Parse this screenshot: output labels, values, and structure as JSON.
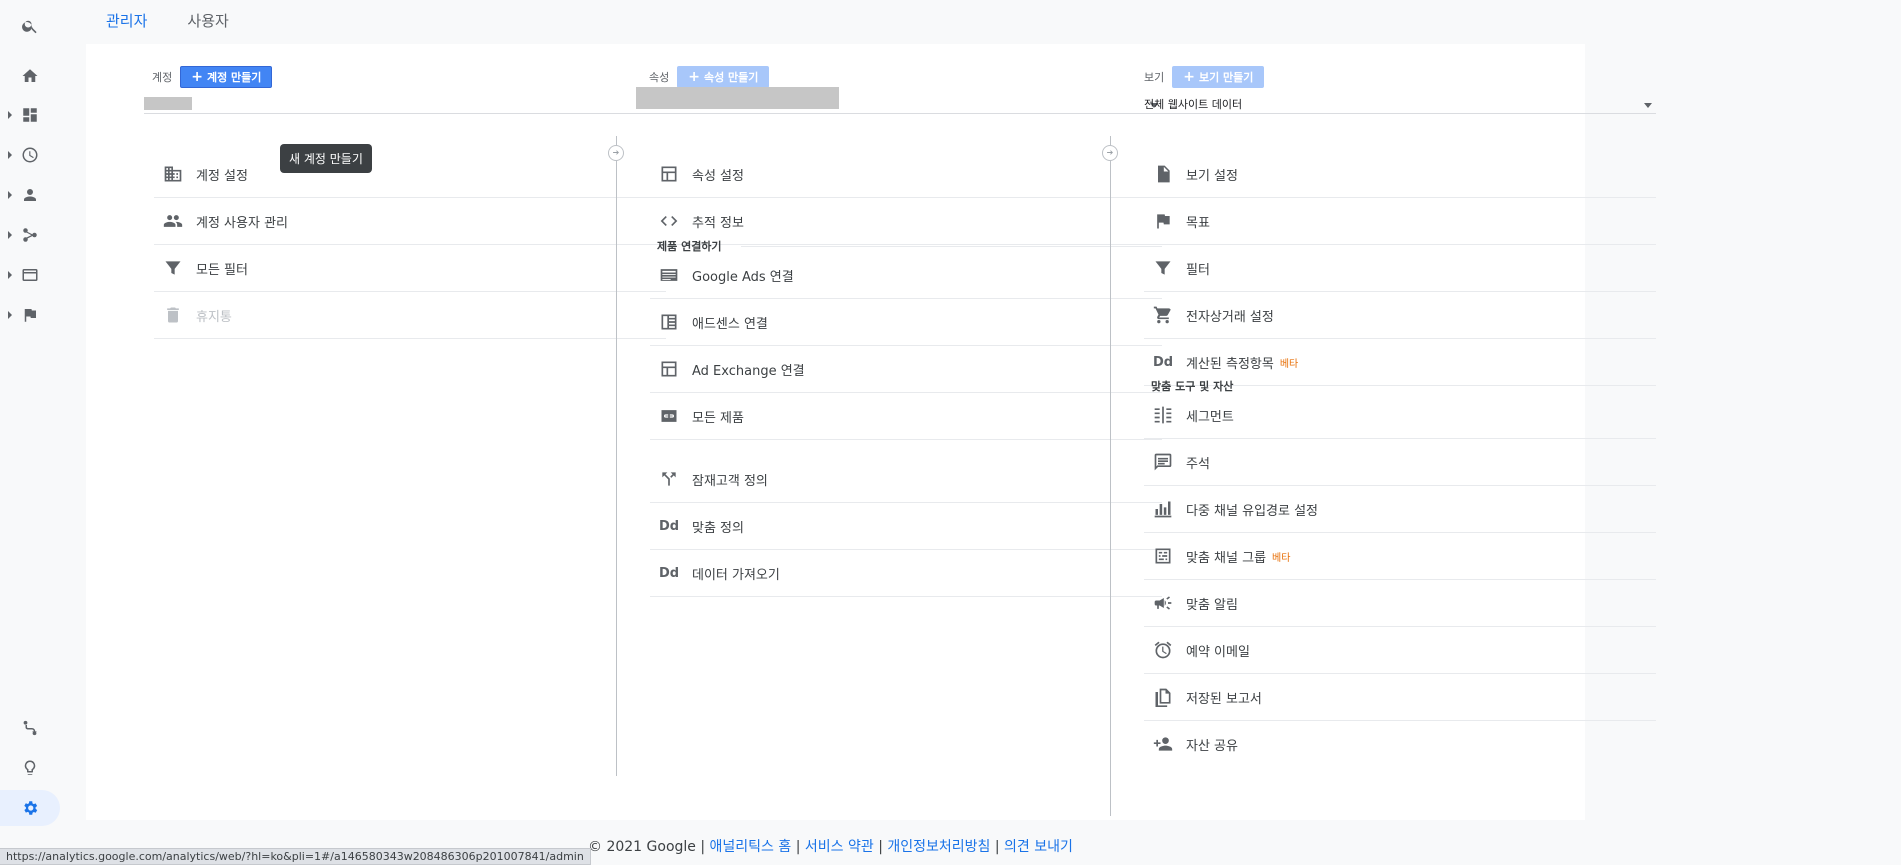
{
  "tabs": [
    {
      "label": "관리자",
      "active": true
    },
    {
      "label": "사용자",
      "active": false
    }
  ],
  "rail": {
    "top_icons": [
      "search-icon"
    ],
    "nav_icons": [
      "home-icon",
      "dashboard-icon",
      "realtime-icon",
      "audience-icon",
      "acquisition-icon",
      "behavior-icon",
      "conversions-icon"
    ],
    "bottom_icons": [
      "attribution-icon",
      "discover-icon",
      "admin-gear-icon"
    ]
  },
  "account": {
    "label": "계정",
    "create_label": "계정 만들기",
    "tooltip": "새 계정 만들기",
    "items": [
      {
        "label": "계정 설정",
        "icon": "building-icon",
        "disabled": false
      },
      {
        "label": "계정 사용자 관리",
        "icon": "people-icon",
        "disabled": false
      },
      {
        "label": "모든 필터",
        "icon": "filter-icon",
        "disabled": false
      },
      {
        "label": "휴지통",
        "icon": "trash-icon",
        "disabled": true
      }
    ]
  },
  "property": {
    "label": "속성",
    "create_label": "속성 만들기",
    "items": [
      {
        "label": "속성 설정",
        "icon": "layout-icon"
      },
      {
        "label": "추적 정보",
        "icon": "code-icon"
      }
    ],
    "product_section": "제품 연결하기",
    "product_items": [
      {
        "label": "Google Ads 연결",
        "icon": "ads-icon"
      },
      {
        "label": "애드센스 연결",
        "icon": "adsense-icon"
      },
      {
        "label": "Ad Exchange 연결",
        "icon": "adexchange-icon"
      },
      {
        "label": "모든 제품",
        "icon": "link-icon"
      }
    ],
    "other_items": [
      {
        "label": "잠재고객 정의",
        "icon": "audience-fork-icon"
      },
      {
        "label": "맞춤 정의",
        "icon": "dd-icon",
        "text_icon": "Dd"
      },
      {
        "label": "데이터 가져오기",
        "icon": "dd-icon",
        "text_icon": "Dd"
      }
    ]
  },
  "view": {
    "label": "보기",
    "create_label": "보기 만들기",
    "selected": "전체 웹사이트 데이터",
    "items": [
      {
        "label": "보기 설정",
        "icon": "document-icon",
        "beta": ""
      },
      {
        "label": "목표",
        "icon": "flag-icon",
        "beta": ""
      },
      {
        "label": "필터",
        "icon": "filter-icon",
        "beta": ""
      },
      {
        "label": "전자상거래 설정",
        "icon": "cart-icon",
        "beta": ""
      },
      {
        "label": "계산된 측정항목",
        "icon": "dd-icon",
        "text_icon": "Dd",
        "beta": "베타"
      }
    ],
    "tools_section": "맞춤 도구 및 자산",
    "tools_items": [
      {
        "label": "세그먼트",
        "icon": "segment-icon",
        "beta": ""
      },
      {
        "label": "주석",
        "icon": "annotation-icon",
        "beta": ""
      },
      {
        "label": "다중 채널 유입경로 설정",
        "icon": "bar-chart-icon",
        "beta": ""
      },
      {
        "label": "맞춤 채널 그룹",
        "icon": "channel-group-icon",
        "beta": "베타"
      },
      {
        "label": "맞춤 알림",
        "icon": "megaphone-icon",
        "beta": ""
      },
      {
        "label": "예약 이메일",
        "icon": "alarm-icon",
        "beta": ""
      },
      {
        "label": "저장된 보고서",
        "icon": "saved-report-icon",
        "beta": ""
      },
      {
        "label": "자산 공유",
        "icon": "person-add-icon",
        "beta": ""
      }
    ]
  },
  "footer": {
    "copyright": "© 2021 Google",
    "links": [
      "애널리틱스 홈",
      "서비스 약관",
      "개인정보처리방침",
      "의견 보내기"
    ],
    "separator": "|"
  },
  "statusbar_url": "https://analytics.google.com/analytics/web/?hl=ko&pli=1#/a146580343w208486306p201007841/admin"
}
